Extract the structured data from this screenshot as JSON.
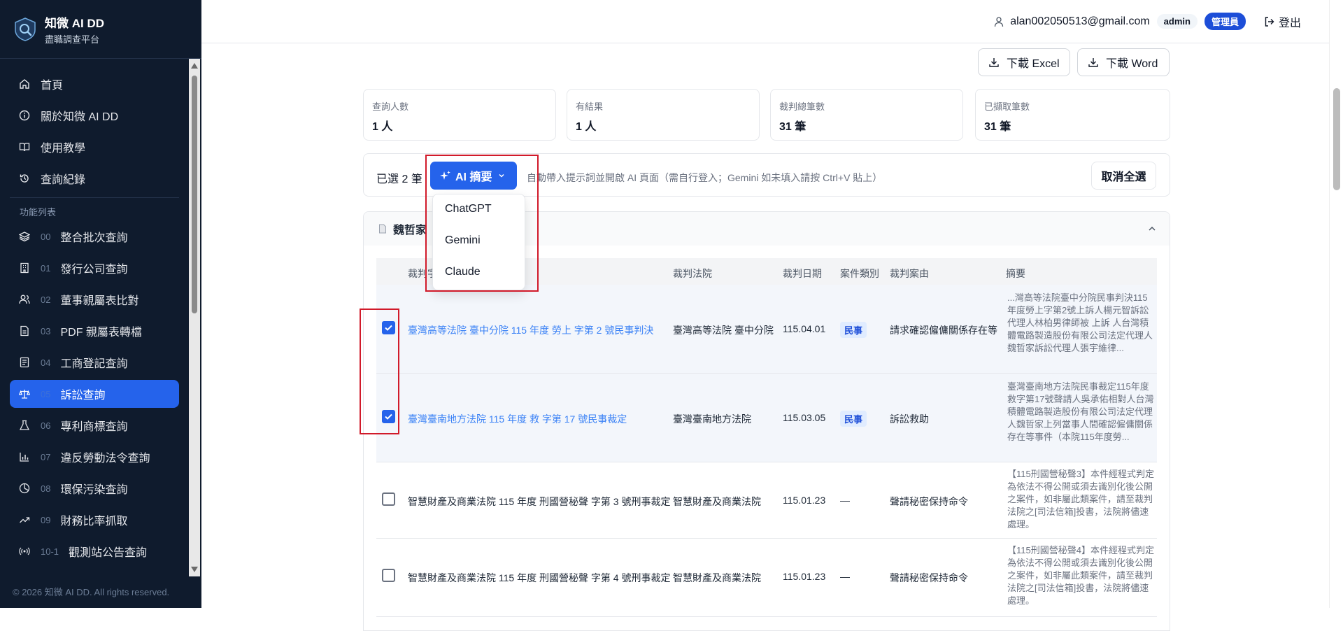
{
  "brand": {
    "title": "知微 AI DD",
    "subtitle": "盡職調查平台"
  },
  "nav": {
    "items": [
      {
        "label": "首頁",
        "icon": "home-icon"
      },
      {
        "label": "關於知微 AI DD",
        "icon": "info-icon"
      },
      {
        "label": "使用教學",
        "icon": "book-icon"
      },
      {
        "label": "查詢紀錄",
        "icon": "history-icon"
      }
    ],
    "section_label": "功能列表",
    "features": [
      {
        "num": "00",
        "label": "整合批次查詢",
        "icon": "layers-icon"
      },
      {
        "num": "01",
        "label": "發行公司查詢",
        "icon": "building-icon"
      },
      {
        "num": "02",
        "label": "董事親屬表比對",
        "icon": "users-icon"
      },
      {
        "num": "03",
        "label": "PDF 親屬表轉檔",
        "icon": "file-icon"
      },
      {
        "num": "04",
        "label": "工商登記查詢",
        "icon": "register-icon"
      },
      {
        "num": "05",
        "label": "訴訟查詢",
        "icon": "scale-icon"
      },
      {
        "num": "06",
        "label": "專利商標查詢",
        "icon": "flask-icon"
      },
      {
        "num": "07",
        "label": "違反勞動法令查詢",
        "icon": "bar-chart-icon"
      },
      {
        "num": "08",
        "label": "環保污染查詢",
        "icon": "pie-chart-icon"
      },
      {
        "num": "09",
        "label": "財務比率抓取",
        "icon": "trend-icon"
      },
      {
        "num": "10-1",
        "label": "觀測站公告查詢",
        "icon": "broadcast-icon"
      }
    ],
    "footer": "© 2026 知微 AI DD. All rights reserved."
  },
  "topbar": {
    "email": "alan002050513@gmail.com",
    "role_badge": "admin",
    "admin_badge": "管理員",
    "logout": "登出"
  },
  "actions": {
    "excel": "下載 Excel",
    "word": "下載 Word"
  },
  "stats": [
    {
      "label": "查詢人數",
      "value": "1 人"
    },
    {
      "label": "有結果",
      "value": "1 人"
    },
    {
      "label": "裁判總筆數",
      "value": "31 筆"
    },
    {
      "label": "已擷取筆數",
      "value": "31 筆"
    }
  ],
  "selection": {
    "count": "已選 2 筆",
    "ai_button": "AI 摘要",
    "hint": "自動帶入提示詞並開啟 AI 頁面（需自行登入；Gemini 如未填入請按 Ctrl+V 貼上）",
    "cancel": "取消全選"
  },
  "dropdown": {
    "options": [
      "ChatGPT",
      "Gemini",
      "Claude"
    ]
  },
  "panel": {
    "title": "魏哲家"
  },
  "table": {
    "headers": [
      "裁判字號",
      "裁判法院",
      "裁判日期",
      "案件類別",
      "裁判案由",
      "摘要"
    ],
    "rows": [
      {
        "checked": true,
        "title": "臺灣高等法院 臺中分院 115 年度 勞上 字第 2 號民事判決",
        "court": "臺灣高等法院 臺中分院",
        "date": "115.04.01",
        "type": "民事",
        "cause": "請求確認僱傭關係存在等",
        "summary": "...灣高等法院臺中分院民事判決115年度勞上字第2號上訴人楊元智訴訟代理人林柏男律師被 上訴 人台灣積體電路製造股份有限公司法定代理人魏哲家訴訟代理人張宇維律..."
      },
      {
        "checked": true,
        "title": "臺灣臺南地方法院 115 年度 救 字第 17 號民事裁定",
        "court": "臺灣臺南地方法院",
        "date": "115.03.05",
        "type": "民事",
        "cause": "訴訟救助",
        "summary": "臺灣臺南地方法院民事裁定115年度救字第17號聲請人吳承佑相對人台灣積體電路製造股份有限公司法定代理人魏哲家上列當事人間確認僱傭關係存在等事件（本院115年度勞..."
      },
      {
        "checked": false,
        "title": "智慧財產及商業法院 115 年度 刑國營秘聲 字第 3 號刑事裁定",
        "court": "智慧財產及商業法院",
        "date": "115.01.23",
        "type": "—",
        "cause": "聲請秘密保持命令",
        "summary": "【115刑國營秘聲3】本件經程式判定為依法不得公開或須去識別化後公開之案件，如非屬此類案件，請至裁判法院之[司法信箱]投書，法院將儘速處理。"
      },
      {
        "checked": false,
        "title": "智慧財產及商業法院 115 年度 刑國營秘聲 字第 4 號刑事裁定",
        "court": "智慧財產及商業法院",
        "date": "115.01.23",
        "type": "—",
        "cause": "聲請秘密保持命令",
        "summary": "【115刑國營秘聲4】本件經程式判定為依法不得公開或須去識別化後公開之案件，如非屬此類案件，請至裁判法院之[司法信箱]投書，法院將儘速處理。"
      }
    ]
  }
}
